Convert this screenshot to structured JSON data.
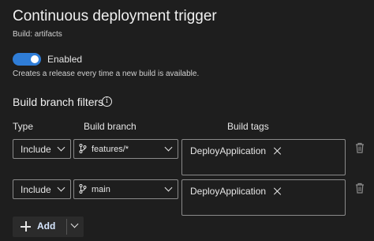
{
  "header": {
    "title": "Continuous deployment trigger",
    "subtitle": "Build: artifacts"
  },
  "toggle": {
    "state": "on",
    "label": "Enabled",
    "description": "Creates a release every time a new build is available.",
    "accent_color": "#2f7dd7"
  },
  "filters": {
    "title": "Build branch filters",
    "columns": {
      "type": "Type",
      "branch": "Build branch",
      "tags": "Build tags"
    },
    "rows": [
      {
        "type": "Include",
        "branch": "features/*",
        "tag": "DeployApplication"
      },
      {
        "type": "Include",
        "branch": "main",
        "tag": "DeployApplication"
      }
    ]
  },
  "actions": {
    "add_label": "Add"
  }
}
